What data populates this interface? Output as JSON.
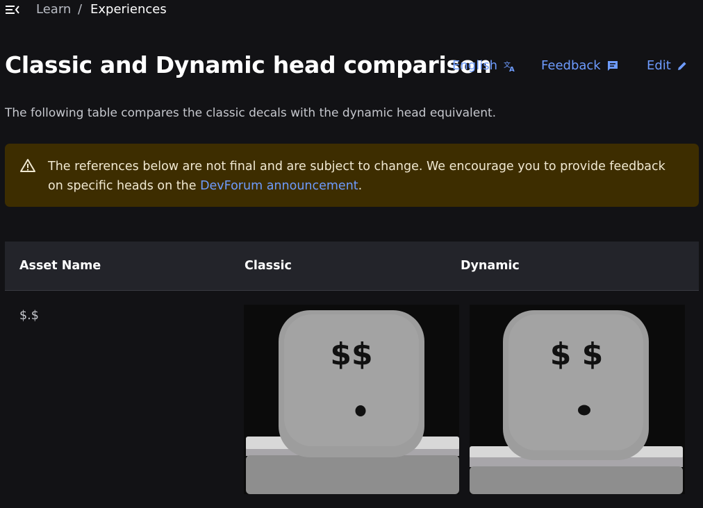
{
  "breadcrumb": {
    "items": [
      "Learn",
      "Experiences"
    ],
    "separator": "/"
  },
  "page": {
    "title": "Classic and Dynamic head comparison",
    "actions": {
      "language": "English",
      "feedback": "Feedback",
      "edit": "Edit"
    },
    "intro": "The following table compares the classic decals with the dynamic head equivalent."
  },
  "alert": {
    "text_before": "The references below are not final and are subject to change. We encourage you to provide feedback on specific heads on the ",
    "link_text": "DevForum announcement",
    "text_after": "."
  },
  "table": {
    "headers": [
      "Asset Name",
      "Classic",
      "Dynamic"
    ],
    "rows": [
      {
        "asset_name": "$.$",
        "classic_face_text": "$$",
        "dynamic_face_text": "$ $"
      }
    ]
  },
  "icons": {
    "menu": "menu-collapse-icon",
    "language": "translate-icon",
    "feedback": "feedback-message-icon",
    "edit": "pencil-icon",
    "alert": "warning-triangle-icon"
  },
  "colors": {
    "background": "#121215",
    "accent_link": "#6e9cff",
    "alert_background": "#3d2d00",
    "table_header_background": "#23242a"
  }
}
